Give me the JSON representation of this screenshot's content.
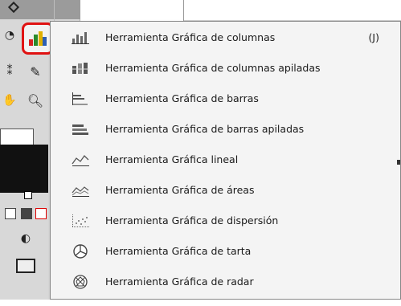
{
  "menu": {
    "items": [
      {
        "label": "Herramienta Gráfica de columnas",
        "shortcut": "(J)",
        "icon": "column-graph-icon"
      },
      {
        "label": "Herramienta Gráfica de columnas apiladas",
        "shortcut": "",
        "icon": "stacked-column-graph-icon"
      },
      {
        "label": "Herramienta Gráfica de barras",
        "shortcut": "",
        "icon": "bar-graph-icon"
      },
      {
        "label": "Herramienta Gráfica de barras apiladas",
        "shortcut": "",
        "icon": "stacked-bar-graph-icon"
      },
      {
        "label": "Herramienta Gráfica lineal",
        "shortcut": "",
        "icon": "line-graph-icon"
      },
      {
        "label": "Herramienta Gráfica de áreas",
        "shortcut": "",
        "icon": "area-graph-icon"
      },
      {
        "label": "Herramienta Gráfica de dispersión",
        "shortcut": "",
        "icon": "scatter-graph-icon"
      },
      {
        "label": "Herramienta Gráfica de tarta",
        "shortcut": "",
        "icon": "pie-graph-icon"
      },
      {
        "label": "Herramienta Gráfica de radar",
        "shortcut": "",
        "icon": "radar-graph-icon"
      }
    ]
  },
  "toolbar": {
    "selected_tool_icon": "graph-tool-icon",
    "highlight_color": "#e01212"
  }
}
